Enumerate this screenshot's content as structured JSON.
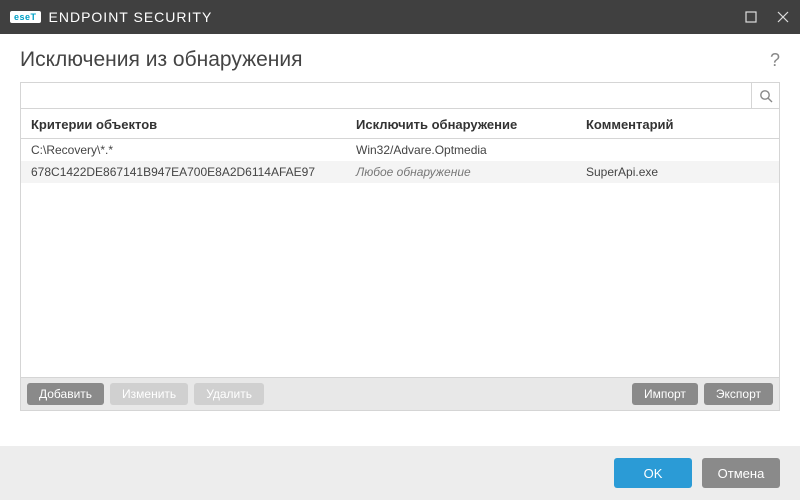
{
  "brand": {
    "badge": "eseT",
    "name": "ENDPOINT SECURITY"
  },
  "page": {
    "title": "Исключения из обнаружения",
    "help": "?"
  },
  "search": {
    "placeholder": ""
  },
  "table": {
    "headers": {
      "criteria": "Критерии объектов",
      "exclude": "Исключить обнаружение",
      "comment": "Комментарий"
    },
    "rows": [
      {
        "criteria": "C:\\Recovery\\*.*",
        "exclude": "Win32/Advare.Optmedia",
        "comment": "",
        "anyDetection": false
      },
      {
        "criteria": "678C1422DE867141B947EA700E8A2D6114AFAE97",
        "exclude": "Любое обнаружение",
        "comment": "SuperApi.exe",
        "anyDetection": true
      }
    ]
  },
  "actions": {
    "add": "Добавить",
    "edit": "Изменить",
    "delete": "Удалить",
    "import": "Импорт",
    "export": "Экспорт"
  },
  "footer": {
    "ok": "OK",
    "cancel": "Отмена"
  }
}
